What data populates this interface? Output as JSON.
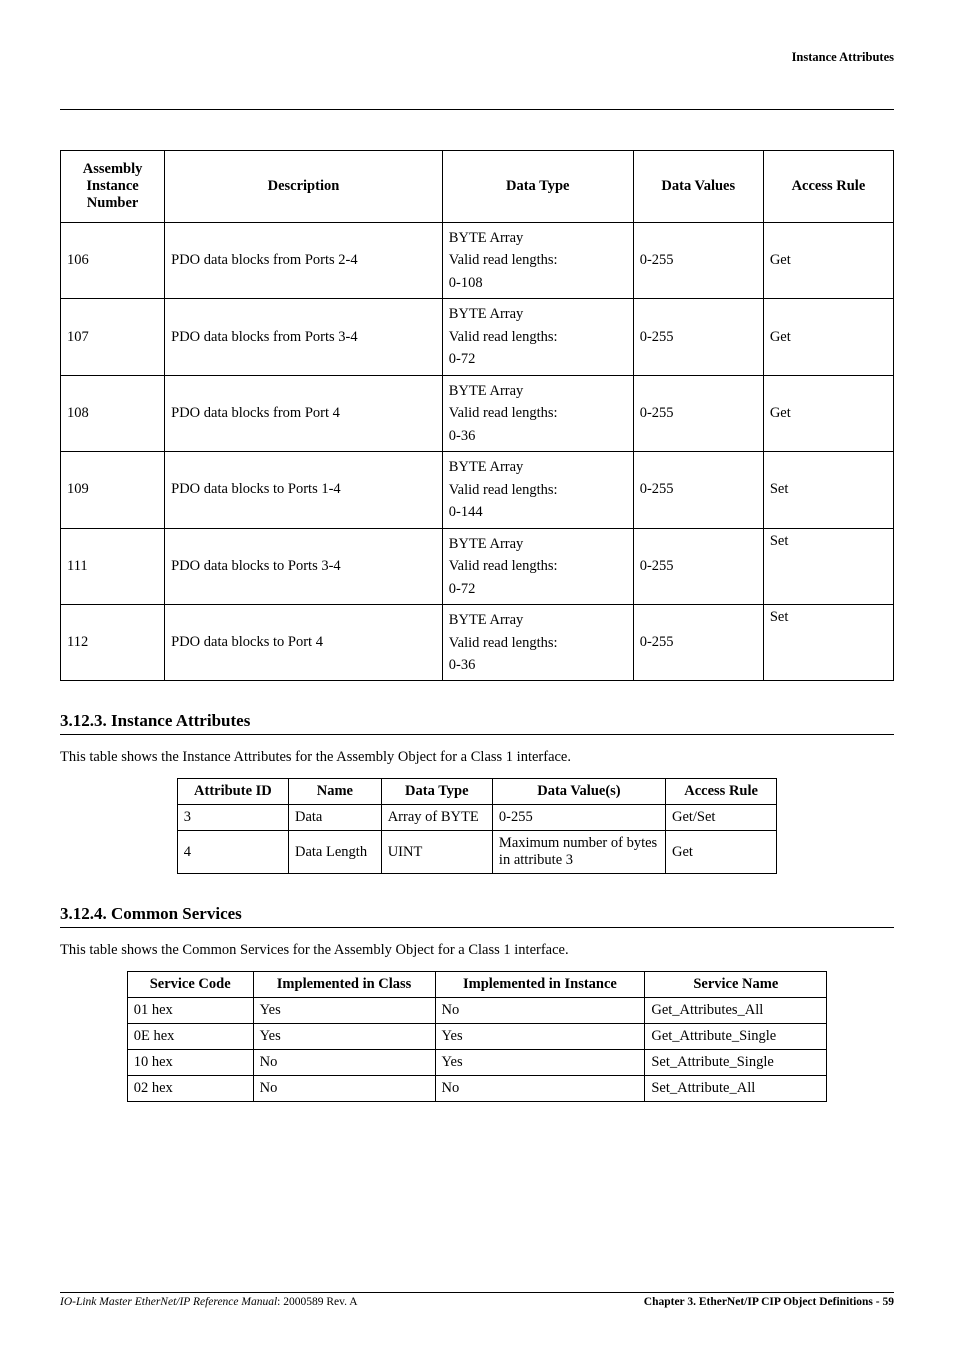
{
  "header": {
    "title": "Instance Attributes"
  },
  "table1": {
    "headers": [
      "Assembly Instance Number",
      "Description",
      "Data Type",
      "Data Values",
      "Access Rule"
    ],
    "rows": [
      {
        "num": "106",
        "desc": "PDO data blocks from Ports 2-4",
        "dt1": "BYTE Array",
        "dt2": "Valid read lengths:",
        "dt3": "0-108",
        "vals": "0-255",
        "rule": "Get"
      },
      {
        "num": "107",
        "desc": "PDO data blocks from Ports 3-4",
        "dt1": "BYTE Array",
        "dt2": "Valid read lengths:",
        "dt3": "0-72",
        "vals": "0-255",
        "rule": "Get"
      },
      {
        "num": "108",
        "desc": "PDO data blocks from Port 4",
        "dt1": "BYTE Array",
        "dt2": "Valid read lengths:",
        "dt3": "0-36",
        "vals": "0-255",
        "rule": "Get"
      },
      {
        "num": "109",
        "desc": "PDO data blocks to Ports 1-4",
        "dt1": "BYTE Array",
        "dt2": "Valid read lengths:",
        "dt3": "0-144",
        "vals": "0-255",
        "rule": "Set"
      },
      {
        "num": "111",
        "desc": "PDO data blocks to Ports 3-4",
        "dt1": "BYTE Array",
        "dt2": "Valid read lengths:",
        "dt3": "0-72",
        "vals": "0-255",
        "rule": "Set"
      },
      {
        "num": "112",
        "desc": "PDO data blocks to Port 4",
        "dt1": "BYTE Array",
        "dt2": "Valid read lengths:",
        "dt3": "0-36",
        "vals": "0-255",
        "rule": "Set"
      }
    ]
  },
  "section1": {
    "heading": "3.12.3. Instance Attributes",
    "intro": "This table shows the Instance Attributes for the Assembly Object for a Class 1 interface."
  },
  "table2": {
    "headers": [
      "Attribute ID",
      "Name",
      "Data Type",
      "Data Value(s)",
      "Access Rule"
    ],
    "rows": [
      {
        "id": "3",
        "name": "Data",
        "dt": "Array of BYTE",
        "val": "0-255",
        "rule": "Get/Set"
      },
      {
        "id": "4",
        "name": "Data Length",
        "dt": "UINT",
        "val": "Maximum number of bytes in attribute 3",
        "rule": "Get"
      }
    ]
  },
  "section2": {
    "heading": "3.12.4. Common Services",
    "intro": "This table shows the Common Services for the Assembly Object for a Class 1 interface."
  },
  "table3": {
    "headers": [
      "Service Code",
      "Implemented in Class",
      "Implemented in Instance",
      "Service Name"
    ],
    "rows": [
      {
        "code": "01 hex",
        "cl": "Yes",
        "inst": "No",
        "name": "Get_Attributes_All"
      },
      {
        "code": "0E hex",
        "cl": "Yes",
        "inst": "Yes",
        "name": "Get_Attribute_Single"
      },
      {
        "code": "10 hex",
        "cl": "No",
        "inst": "Yes",
        "name": "Set_Attribute_Single"
      },
      {
        "code": "02 hex",
        "cl": "No",
        "inst": "No",
        "name": "Set_Attribute_All"
      }
    ]
  },
  "footer": {
    "left_title": "IO-Link Master EtherNet/IP Reference Manual",
    "left_suffix": ": 2000589 Rev. A",
    "right": "Chapter 3. EtherNet/IP CIP Object Definitions  - 59"
  }
}
